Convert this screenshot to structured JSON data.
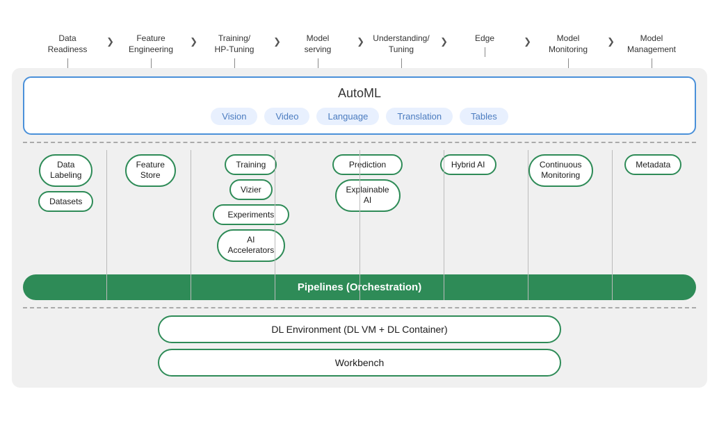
{
  "nav": {
    "items": [
      {
        "label": "Data\nReadiness",
        "id": "data-readiness"
      },
      {
        "label": "Feature\nEngineering",
        "id": "feature-engineering"
      },
      {
        "label": "Training/\nHP-Tuning",
        "id": "training-hp"
      },
      {
        "label": "Model\nserving",
        "id": "model-serving"
      },
      {
        "label": "Understanding/\nTuning",
        "id": "understanding-tuning"
      },
      {
        "label": "Edge",
        "id": "edge"
      },
      {
        "label": "Model\nMonitoring",
        "id": "model-monitoring"
      },
      {
        "label": "Model\nManagement",
        "id": "model-management"
      }
    ]
  },
  "automl": {
    "title": "AutoML",
    "chips": [
      "Vision",
      "Video",
      "Language",
      "Translation",
      "Tables"
    ]
  },
  "services": {
    "col1": [
      "Data\nLabeling",
      "Datasets"
    ],
    "col2": [
      "Feature\nStore"
    ],
    "col3": [
      "Training",
      "Vizier",
      "Experiments",
      "AI\nAccelerators"
    ],
    "col4": [
      "Prediction",
      "Explainable\nAI"
    ],
    "col5": [
      "Hybrid AI"
    ],
    "col6": [
      "Continuous\nMonitoring"
    ],
    "col7": [
      "Metadata"
    ]
  },
  "pipelines": {
    "label": "Pipelines (Orchestration)"
  },
  "bottom": {
    "dl_env": "DL Environment (DL VM + DL Container)",
    "workbench": "Workbench"
  }
}
